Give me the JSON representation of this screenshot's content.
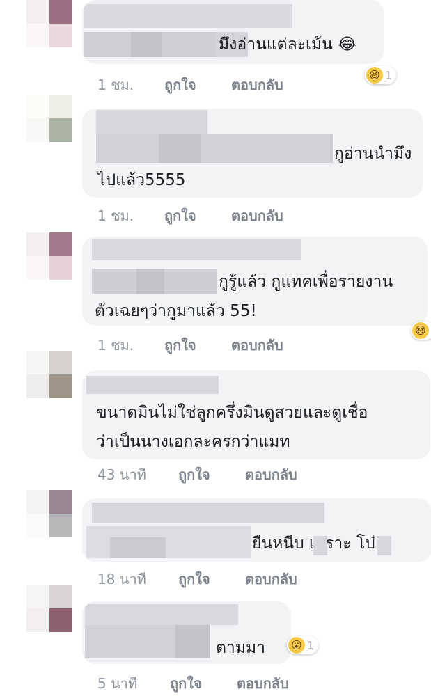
{
  "comments": [
    {
      "text": "มึงอ่านแต่ละเม้น 😂",
      "time": "1 ชม.",
      "like": "ถูกใจ",
      "reply": "ตอบกลับ",
      "reaction_count": "1",
      "reaction_icon": "laugh-icon"
    },
    {
      "text_line1": "กูอ่านนำมึง",
      "text_line2": "ไปแล้ว5555",
      "time": "1 ชม.",
      "like": "ถูกใจ",
      "reply": "ตอบกลับ"
    },
    {
      "text_line1": "กูรู้แล้ว กูแทคเพื่อรายงาน",
      "text_line2": "ตัวเฉยๆว่ากูมาแล้ว 55!",
      "time": "1 ชม.",
      "like": "ถูกใจ",
      "reply": "ตอบกลับ",
      "reaction_icon": "laugh-icon"
    },
    {
      "text_line1": "ขนาดมินไม่ใช่ลูกครึ่งมินดูสวยและดูเชื่อ",
      "text_line2": "ว่าเป็นนางเอกละครกว่าแมท",
      "time": "43 นาที",
      "like": "ถูกใจ",
      "reply": "ตอบกลับ"
    },
    {
      "text": "ยืนหนีบ  เพราะ  โบ๋",
      "time": "18 นาที",
      "like": "ถูกใจ",
      "reply": "ตอบกลับ"
    },
    {
      "text": "ตามมา",
      "time": "5 นาที",
      "like": "ถูกใจ",
      "reply": "ตอบกลับ",
      "reaction_count": "1",
      "reaction_icon": "wow-icon"
    }
  ],
  "colors": {
    "bubble": "#f2f3f5",
    "meta_text": "#8d949e",
    "body_text": "#1c1e21"
  }
}
